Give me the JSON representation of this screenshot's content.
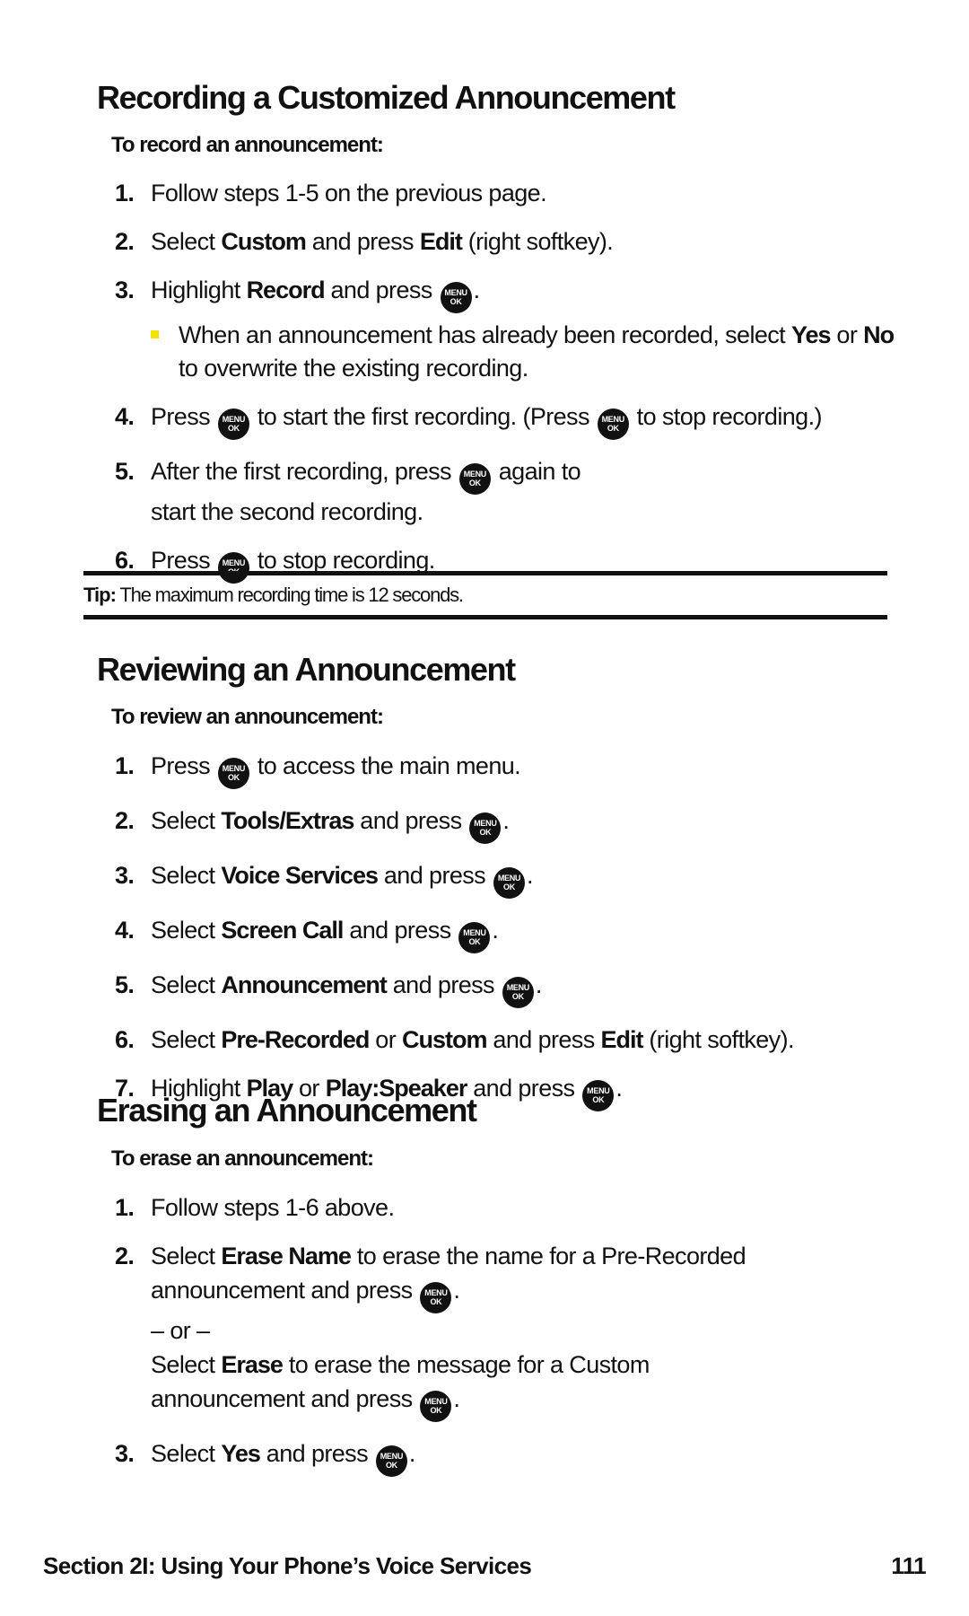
{
  "sections": [
    {
      "title": "Recording a Customized Announcement",
      "subhead": "To record an announcement:",
      "steps": [
        {
          "num": "1.",
          "parts": [
            "Follow steps 1-5 on the previous page."
          ]
        },
        {
          "num": "2.",
          "parts": [
            "Select ",
            "Custom",
            " and press ",
            "Edit",
            " (right softkey)."
          ]
        },
        {
          "num": "3.",
          "parts": [
            "Highlight ",
            "Record",
            " and press ",
            "."
          ],
          "bullet": {
            "parts": [
              "When an announcement has already been recorded, select ",
              "Yes",
              " or ",
              "No",
              " to overwrite the existing recording."
            ]
          }
        },
        {
          "num": "4.",
          "parts": [
            "Press ",
            " to start the first recording. (Press ",
            " to stop recording.)"
          ]
        },
        {
          "num": "5.",
          "parts": [
            "After the first recording, press ",
            " again to start the second recording."
          ]
        },
        {
          "num": "6.",
          "parts": [
            "Press ",
            " to stop recording."
          ]
        }
      ]
    },
    {
      "title": "Reviewing an Announcement",
      "subhead": "To review an announcement:",
      "steps": [
        {
          "num": "1.",
          "parts": [
            "Press ",
            " to access the main menu."
          ]
        },
        {
          "num": "2.",
          "parts": [
            "Select ",
            "Tools/Extras",
            " and press ",
            "."
          ]
        },
        {
          "num": "3.",
          "parts": [
            "Select ",
            "Voice Services",
            " and press ",
            "."
          ]
        },
        {
          "num": "4.",
          "parts": [
            "Select ",
            "Screen Call",
            " and press ",
            "."
          ]
        },
        {
          "num": "5.",
          "parts": [
            "Select ",
            "Announcement",
            " and press ",
            "."
          ]
        },
        {
          "num": "6.",
          "parts": [
            "Select ",
            "Pre-Recorded",
            " or ",
            "Custom",
            " and press ",
            "Edit",
            " (right softkey)."
          ]
        },
        {
          "num": "7.",
          "parts": [
            "Highlight ",
            "Play",
            " or ",
            "Play:Speaker",
            " and press ",
            "."
          ]
        }
      ]
    },
    {
      "title": "Erasing an Announcement",
      "subhead": "To erase an announcement:",
      "steps": [
        {
          "num": "1.",
          "parts": [
            "Follow steps 1-6 above."
          ]
        },
        {
          "num": "2.",
          "parts": [
            "Select ",
            "Erase Name",
            " to erase the name for a Pre-Recorded announcement and press ",
            "."
          ],
          "or": "– or –",
          "alt_parts": [
            "Select ",
            "Erase",
            " to erase the message for a Custom announcement and press ",
            "."
          ]
        },
        {
          "num": "3.",
          "parts": [
            "Select ",
            "Yes",
            " and press ",
            "."
          ]
        }
      ]
    }
  ],
  "tip": {
    "label": "Tip:",
    "text": " The maximum recording time is 12 seconds."
  },
  "key_icon": {
    "name": "menu-ok-key",
    "line1": "MENU",
    "line2": "OK"
  },
  "footer": {
    "section": "Section 2I: Using Your Phone’s Voice Services",
    "page_number": "111"
  },
  "colors": {
    "text": "#111111",
    "bullet": "#f4e100",
    "background": "#ffffff"
  }
}
